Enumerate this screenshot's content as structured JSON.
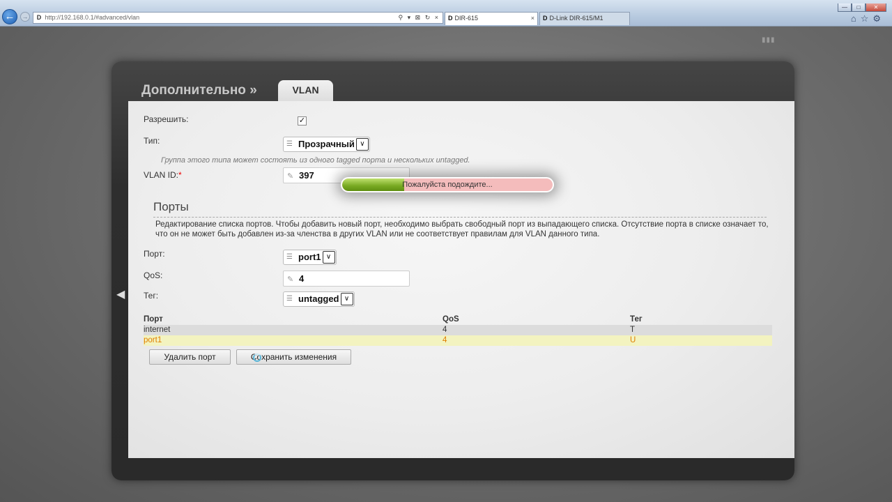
{
  "browser": {
    "address": "http://192.168.0.1/#advanced/vlan",
    "address_icons": "⚲ ▾ ⊠ ↻ ×",
    "tabs": [
      {
        "label": "DIR-615",
        "active": true
      },
      {
        "label": "D-Link DIR-615/M1",
        "active": false
      }
    ],
    "window_controls": [
      "—",
      "□",
      "✕"
    ],
    "tool_icons": [
      "home-icon",
      "star-icon",
      "gear-icon"
    ]
  },
  "panel": {
    "breadcrumb": "Дополнительно »",
    "page_tab": "VLAN"
  },
  "form": {
    "enable_label": "Разрешить:",
    "enable_checked": true,
    "type_label": "Тип:",
    "type_value": "Прозрачный",
    "type_hint": "Группа этого типа может состоять из одного tagged порта и нескольких untagged.",
    "vlan_id_label": "VLAN ID:",
    "vlan_id_value": "397"
  },
  "ports": {
    "title": "Порты",
    "description": "Редактирование списка портов. Чтобы добавить новый порт, необходимо выбрать свободный порт из выпадающего списка. Отсутствие порта в списке означает то, что он не может быть добавлен из-за членства в других VLAN или не соответствует правилам для VLAN данного типа.",
    "port_label": "Порт:",
    "port_value": "port1",
    "qos_label": "QoS:",
    "qos_value": "4",
    "tag_label": "Тег:",
    "tag_value": "untagged",
    "table": {
      "headers": [
        "Порт",
        "QoS",
        "Тег"
      ],
      "rows": [
        [
          "internet",
          "4",
          "T"
        ],
        [
          "port1",
          "4",
          "U"
        ]
      ],
      "selected_row": 1
    }
  },
  "buttons": {
    "delete": "Удалить порт",
    "save": "Сохранить изменения"
  },
  "wait": {
    "text": "Пожалуйста подождите...",
    "progress": 0.295
  },
  "colors": {
    "accent_selected_row": "#e07f00",
    "progress_green": "#77a821",
    "popup_pink": "#f4bcbc"
  }
}
